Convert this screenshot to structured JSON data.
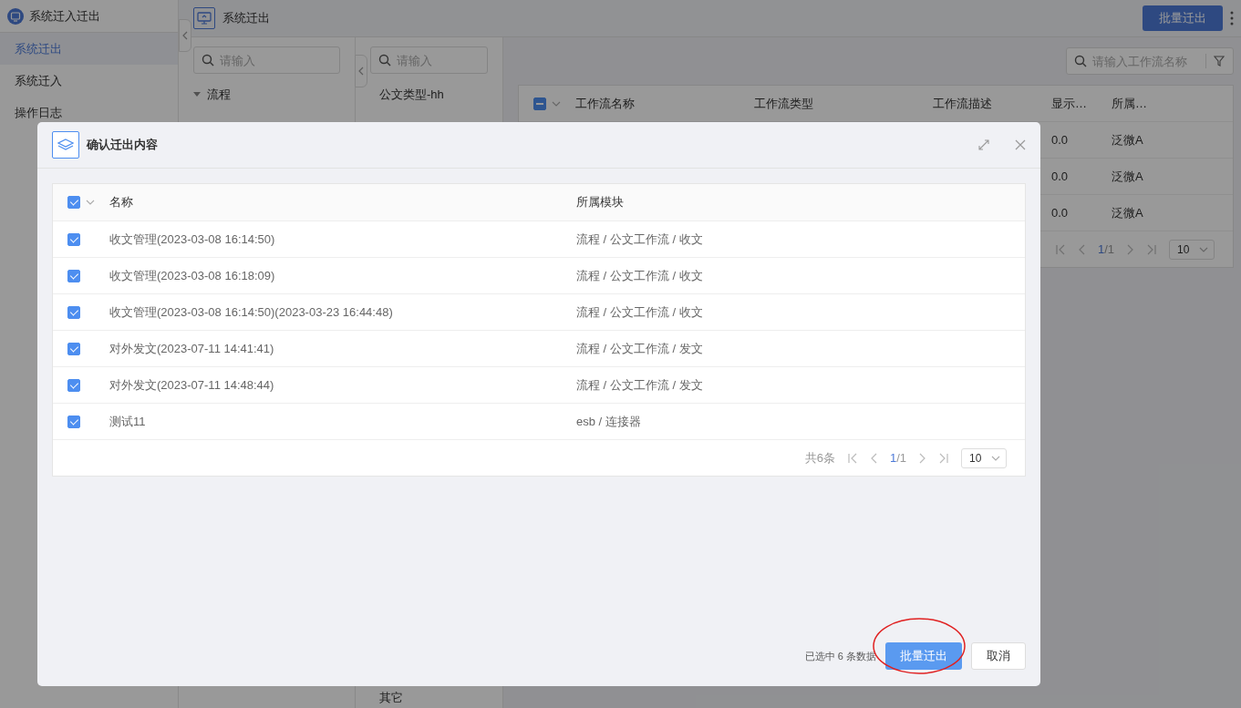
{
  "app_title": "系统迁入迁出",
  "sidebar": {
    "items": [
      {
        "label": "系统迁出",
        "selected": true
      },
      {
        "label": "系统迁入",
        "selected": false
      },
      {
        "label": "操作日志",
        "selected": false
      }
    ]
  },
  "header": {
    "title": "系统迁出",
    "action": "批量迁出"
  },
  "tree_panel": {
    "search": {
      "placeholder": "请输入"
    },
    "nodes": [
      {
        "label": "流程",
        "expanded": true
      }
    ]
  },
  "type_panel": {
    "search": {
      "placeholder": "请输入"
    },
    "items": [
      "公文类型-hh"
    ],
    "bottom_item": "其它"
  },
  "workflow_panel": {
    "search": {
      "placeholder": "请输入工作流名称"
    },
    "table": {
      "select_all": {
        "indeterminate": true
      },
      "columns": [
        "工作流名称",
        "工作流类型",
        "工作流描述",
        "显示…",
        "所属…"
      ],
      "rows": [
        {
          "column_4": "0.0",
          "column_5": "泛微A"
        },
        {
          "column_4": "0.0",
          "column_5": "泛微A"
        },
        {
          "column_4": "0.0",
          "column_5": "泛微A"
        }
      ]
    },
    "pagination": {
      "page_current": "1",
      "page_total": "/1",
      "page_size": "10"
    }
  },
  "dialog": {
    "title": "确认迁出内容",
    "table": {
      "select_all": {
        "checked": true
      },
      "columns": [
        "名称",
        "所属模块"
      ],
      "rows": [
        {
          "name": "收文管理(2023-03-08 16:14:50)",
          "module": "流程 / 公文工作流 / 收文",
          "checked": true
        },
        {
          "name": "收文管理(2023-03-08 16:18:09)",
          "module": "流程 / 公文工作流 / 收文",
          "checked": true
        },
        {
          "name": "收文管理(2023-03-08 16:14:50)(2023-03-23 16:44:48)",
          "module": "流程 / 公文工作流 / 收文",
          "checked": true
        },
        {
          "name": "对外发文(2023-07-11 14:41:41)",
          "module": "流程 / 公文工作流 / 发文",
          "checked": true
        },
        {
          "name": "对外发文(2023-07-11 14:48:44)",
          "module": "流程 / 公文工作流 / 发文",
          "checked": true
        },
        {
          "name": "测试11",
          "module": "esb / 连接器",
          "checked": true
        }
      ]
    },
    "pagination": {
      "total": "共6条",
      "page_current": "1",
      "page_total": "/1",
      "page_size": "10"
    },
    "selection_note": "已选中 6 条数据",
    "buttons": [
      {
        "label": "批量迁出",
        "kind": "primary",
        "highlighted": true
      },
      {
        "label": "取消",
        "kind": "default",
        "highlighted": false
      }
    ]
  }
}
